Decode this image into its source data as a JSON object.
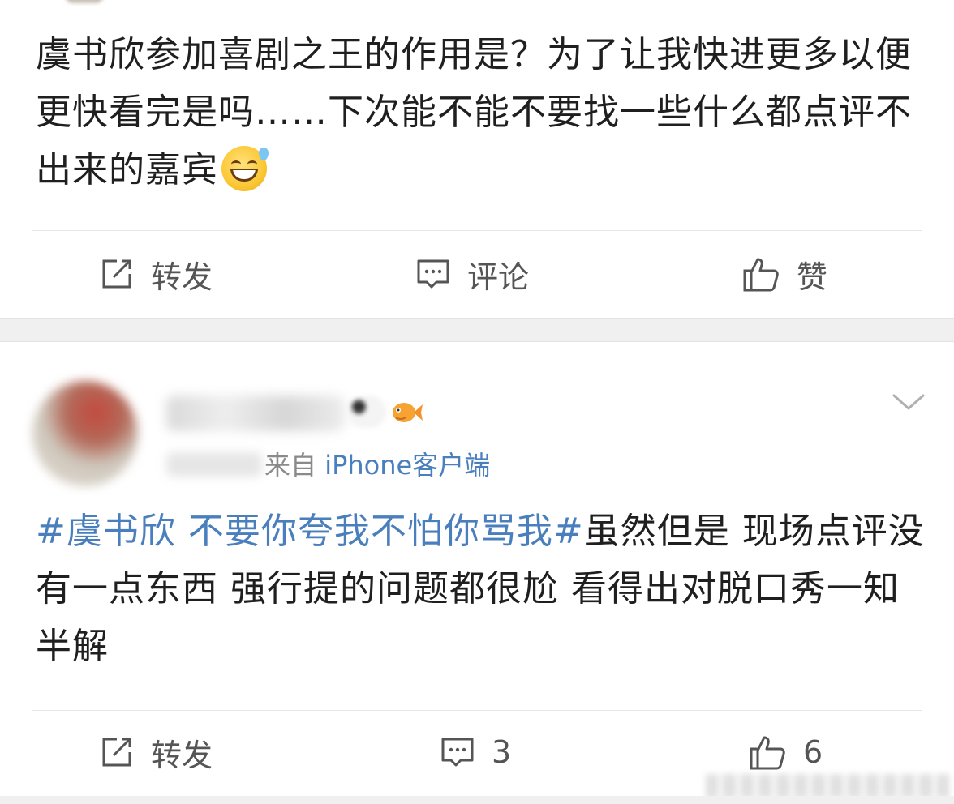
{
  "post1": {
    "text": "虞书欣参加喜剧之王的作用是？为了让我快进更多以便更快看完是吗……下次能不能不要找一些什么都点评不出来的嘉宾",
    "emoji": "grinning-sweat-emoji",
    "actions": {
      "repost_label": "转发",
      "comment_label": "评论",
      "like_label": "赞"
    }
  },
  "post2": {
    "source_prefix": "来自",
    "source_client": "iPhone客户端",
    "hashtag": "#虞书欣 不要你夸我不怕你骂我#",
    "text": "虽然但是 现场点评没有一点东西 强行提的问题都很尬 看得出对脱口秀一知半解",
    "actions": {
      "repost_label": "转发",
      "comment_count": "3",
      "like_count": "6"
    }
  },
  "colors": {
    "link": "#4a7fbd",
    "text": "#1f1f1f",
    "secondary": "#8a8a8a",
    "separator": "#f0f0f0"
  }
}
